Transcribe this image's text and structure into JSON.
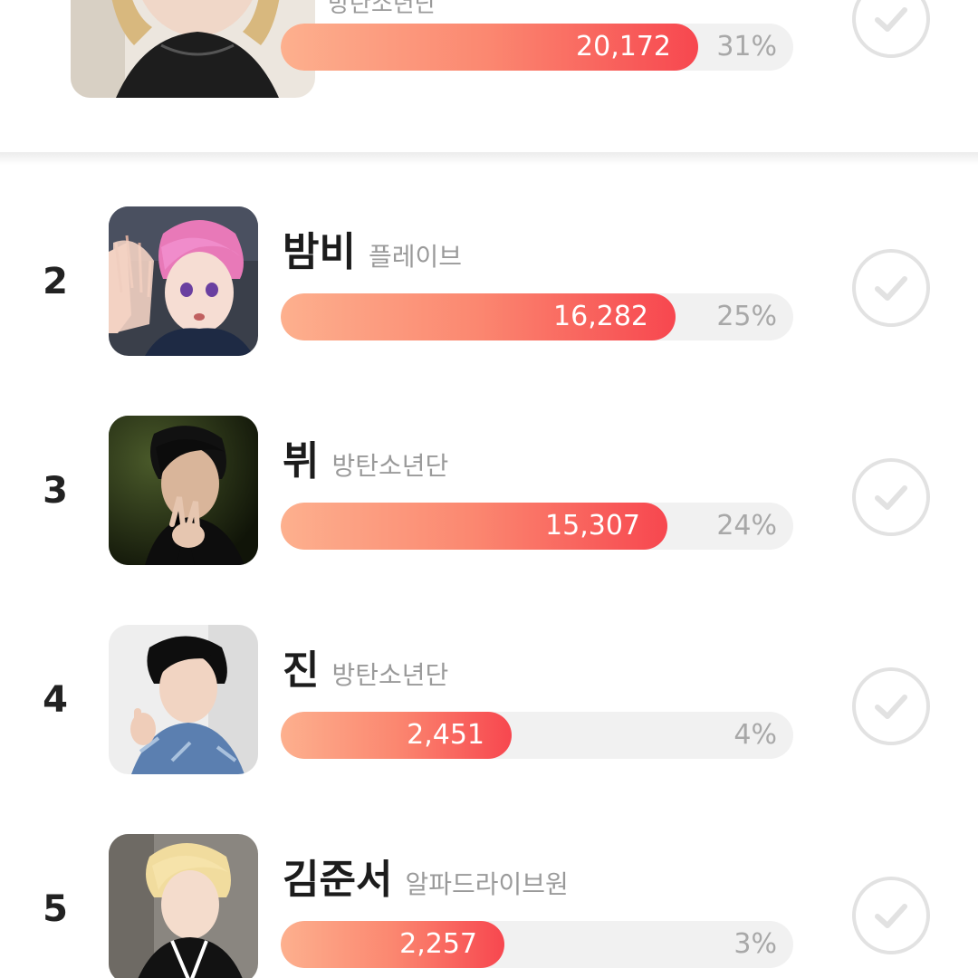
{
  "top_entry": {
    "group_partial": "방탄소년단",
    "votes": "20,172",
    "percent": "31%",
    "fill_fraction": 0.815,
    "photo_icon": "portrait-photo"
  },
  "entries": [
    {
      "rank": "2",
      "name": "밤비",
      "group": "플레이브",
      "votes": "16,282",
      "percent": "25%",
      "fill_fraction": 0.77
    },
    {
      "rank": "3",
      "name": "뷔",
      "group": "방탄소년단",
      "votes": "15,307",
      "percent": "24%",
      "fill_fraction": 0.755
    },
    {
      "rank": "4",
      "name": "진",
      "group": "방탄소년단",
      "votes": "2,451",
      "percent": "4%",
      "fill_fraction": 0.45
    },
    {
      "rank": "5",
      "name": "김준서",
      "group": "알파드라이브원",
      "votes": "2,257",
      "percent": "3%",
      "fill_fraction": 0.437
    }
  ],
  "icons": {
    "vote": "check-circle-icon",
    "photo": "portrait-photo"
  },
  "colors": {
    "bar_start": "#fdb08e",
    "bar_end": "#f7474f",
    "track": "#f1f1f1",
    "check": "#e2e2e2"
  }
}
